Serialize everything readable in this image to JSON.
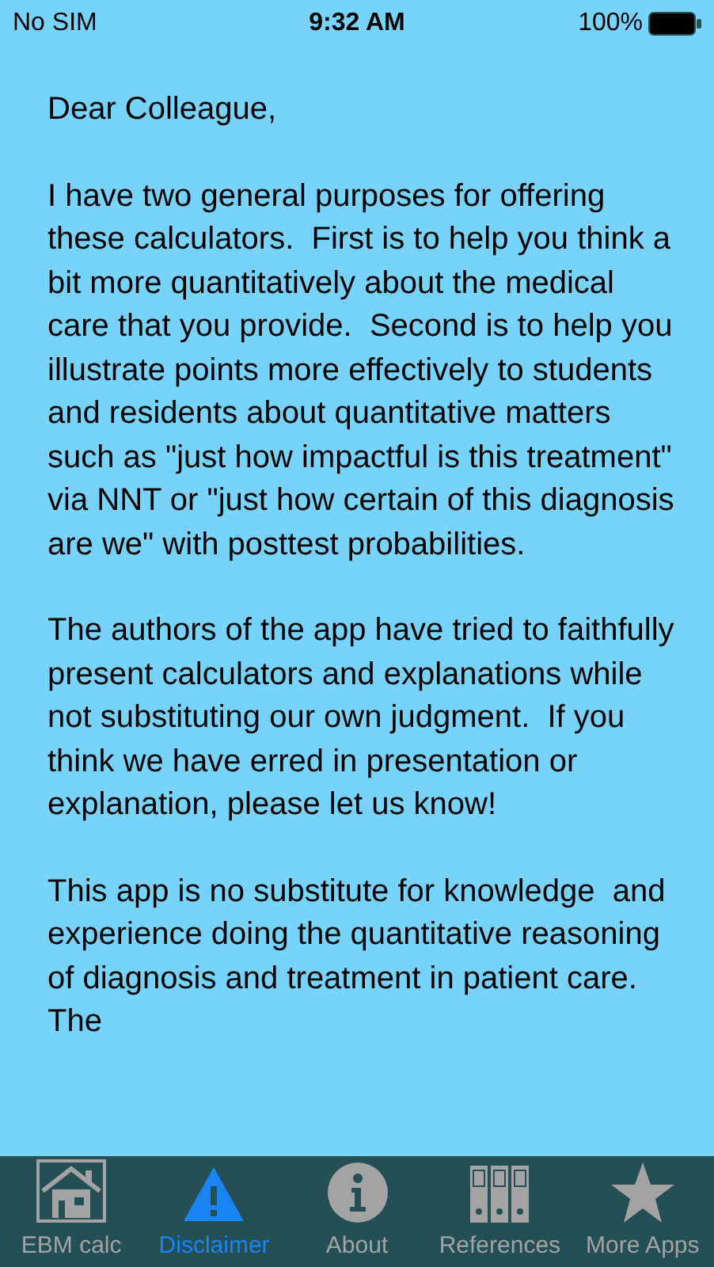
{
  "status_bar": {
    "carrier": "No SIM",
    "time": "9:32 AM",
    "battery": "100%"
  },
  "letter": {
    "greeting": "Dear Colleague,",
    "paragraphs": [
      "I have two general purposes for offering these calculators.  First is to help you think a bit more quantitatively about the medical care that you provide.  Second is to help you illustrate points more effectively to students and residents about quantitative matters such as \"just how impactful is this treatment\" via NNT or \"just how certain of this diagnosis are we\" with posttest probabilities.",
      "The authors of the app have tried to faithfully present calculators and explanations while not substituting our own judgment.  If you think we have erred in presentation or explanation, please let us know!",
      "This app is no substitute for knowledge  and experience doing the quantitative reasoning of diagnosis and treatment in patient care.  The"
    ]
  },
  "tabs": [
    {
      "label": "EBM calc",
      "kind": "house",
      "selected": false
    },
    {
      "label": "Disclaimer",
      "kind": "warning",
      "selected": true
    },
    {
      "label": "About",
      "kind": "info",
      "selected": false
    },
    {
      "label": "References",
      "kind": "binders",
      "selected": false
    },
    {
      "label": "More Apps",
      "kind": "star",
      "selected": false
    }
  ]
}
